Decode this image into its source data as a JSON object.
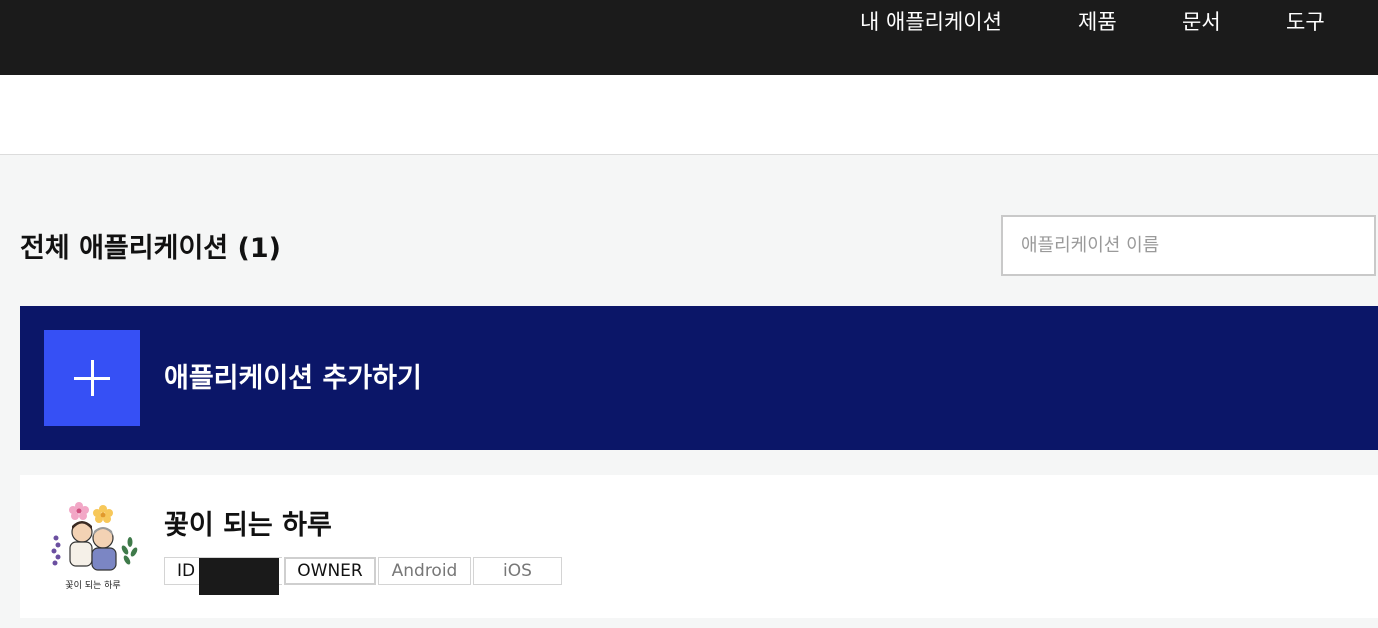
{
  "top_nav": {
    "items": [
      {
        "label": "내 애플리케이션"
      },
      {
        "label": "제품"
      },
      {
        "label": "문서"
      },
      {
        "label": "도구"
      }
    ]
  },
  "main": {
    "title": "전체 애플리케이션 (1)",
    "search": {
      "placeholder": "애플리케이션 이름",
      "value": ""
    },
    "add_button": {
      "label": "애플리케이션 추가하기",
      "icon": "plus-icon"
    },
    "apps": [
      {
        "name": "꽃이 되는 하루",
        "logo_caption": "꽃이 되는 하루",
        "tags": {
          "id": "ID",
          "role": "OWNER",
          "platforms": [
            "Android",
            "iOS"
          ]
        }
      }
    ]
  },
  "colors": {
    "top_bar": "#1b1b1b",
    "banner": "#0b1668",
    "add_icon_box": "#3650f5",
    "page_bg": "#f5f6f6"
  }
}
